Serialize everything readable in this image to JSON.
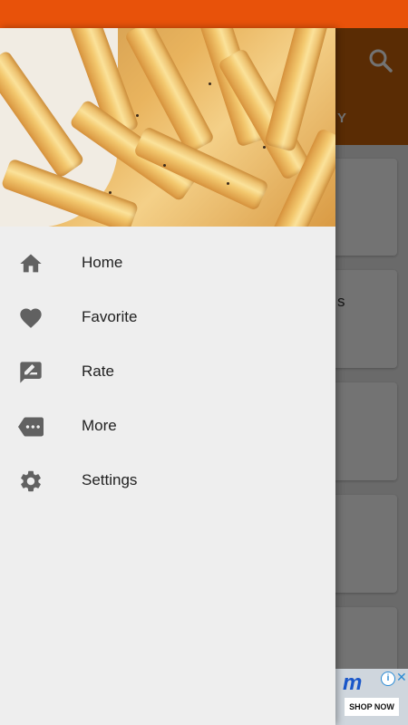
{
  "background": {
    "tab_partial": "Y",
    "card_partial_text": "s"
  },
  "ad": {
    "logo_text": "m",
    "info_symbol": "i",
    "close_symbol": "✕",
    "cta": "SHOP NOW"
  },
  "drawer": {
    "menu": [
      {
        "label": "Home",
        "icon": "home-icon"
      },
      {
        "label": "Favorite",
        "icon": "heart-icon"
      },
      {
        "label": "Rate",
        "icon": "rate-review-icon"
      },
      {
        "label": "More",
        "icon": "more-tag-icon"
      },
      {
        "label": "Settings",
        "icon": "gear-icon"
      }
    ]
  },
  "colors": {
    "status_bar": "#e8520a",
    "app_bar": "#c8620a",
    "drawer_bg": "#eeeeee",
    "icon": "#616161"
  }
}
